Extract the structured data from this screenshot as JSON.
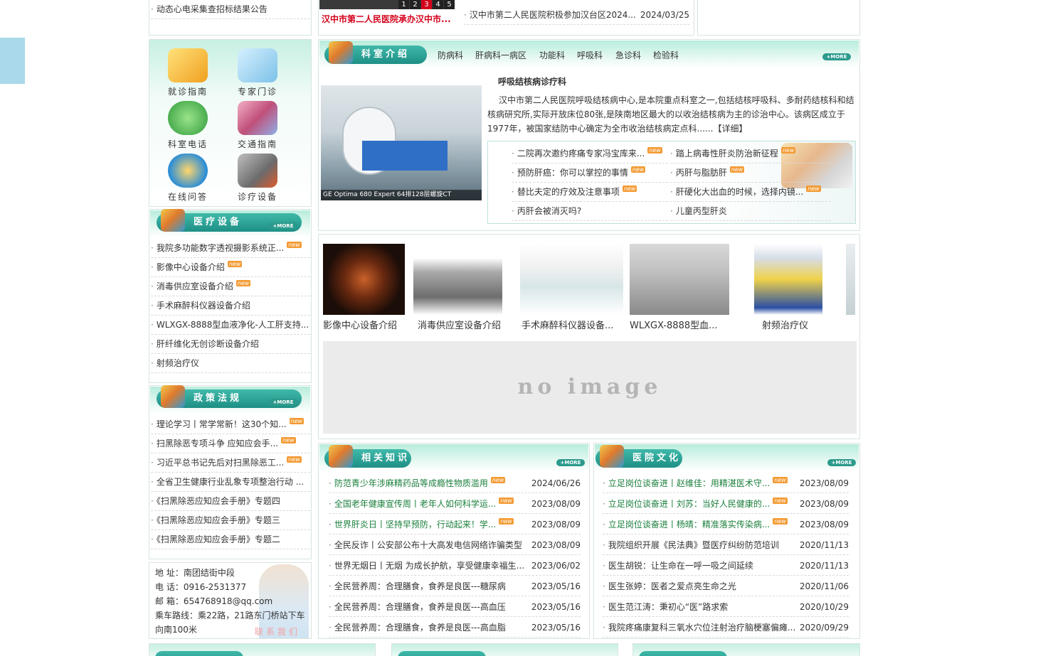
{
  "top": {
    "left_item": "动态心电采集查招标结果公告",
    "slider_caption": "汉中市第二人民医院承办汉中市...",
    "slider_pages": [
      "1",
      "2",
      "3",
      "4",
      "5"
    ],
    "news_item": "汉中市第二人民医院积极参加汉台区2024...",
    "news_date": "2024/03/25"
  },
  "guide": {
    "items": [
      {
        "label": "就诊指南",
        "icon": "scroll-icon"
      },
      {
        "label": "专家门诊",
        "icon": "syringe-icon"
      },
      {
        "label": "科室电话",
        "icon": "phone-icon"
      },
      {
        "label": "交通指南",
        "icon": "castle-icon"
      },
      {
        "label": "在线问答",
        "icon": "globe-mailbox-icon"
      },
      {
        "label": "诊疗设备",
        "icon": "computer-icon"
      }
    ]
  },
  "equipment": {
    "title": "医疗设备",
    "more": "+MORE",
    "items": [
      {
        "text": "我院多功能数字透视摄影系统正...",
        "new": true
      },
      {
        "text": "影像中心设备介绍",
        "new": true
      },
      {
        "text": "消毒供应室设备介绍",
        "new": true
      },
      {
        "text": "手术麻醉科仪器设备介绍",
        "new": false
      },
      {
        "text": "WLXGX-8888型血液净化-人工肝支持...",
        "new": false
      },
      {
        "text": "肝纤维化无创诊断设备介绍",
        "new": false
      },
      {
        "text": "射频治疗仪",
        "new": false
      }
    ]
  },
  "policy": {
    "title": "政策法规",
    "more": "+MORE",
    "items": [
      {
        "text": "理论学习丨常学常新！这30个知...",
        "new": true
      },
      {
        "text": "扫黑除恶专项斗争 应知应会手...",
        "new": true
      },
      {
        "text": "习近平总书记先后对扫黑除恶工...",
        "new": true
      },
      {
        "text": "全省卫生健康行业乱象专项整治行动 ...",
        "new": false
      },
      {
        "text": "《扫黑除恶应知应会手册》专题四",
        "new": false
      },
      {
        "text": "《扫黑除恶应知应会手册》专题三",
        "new": false
      },
      {
        "text": "《扫黑除恶应知应会手册》专题二",
        "new": false
      }
    ]
  },
  "contact": {
    "address": "地 址：南团结街中段",
    "phone": "电 话：0916-2531377",
    "email": "邮 箱：654768918@qq.com",
    "route": "乘车路线：乘22路，21路东门桥站下车向南100米",
    "badge": "联系我们"
  },
  "departments": {
    "title": "科室介绍",
    "more": "+MORE",
    "tabs": [
      "防病科",
      "肝病科一病区",
      "功能科",
      "呼吸科",
      "急诊科",
      "检验科"
    ],
    "feature_title": "呼吸结核病诊疗科",
    "feature_text": "汉中市第二人民医院呼吸结核病中心,是本院重点科室之一,包括结核呼吸科、多耐药结核科和结核病研究所,实际开放床位80张,是陕南地区最大的以收治结核病为主的诊治中心。该病区成立于1977年，被国家结防中心确定为全市收治结核病定点科......",
    "detail_link": "【详细】",
    "photo_caption": "GE Optima 680 Expert 64排128层螺旋CT",
    "links_left": [
      {
        "text": "二院再次邀约疼痛专家冯宝库来...",
        "new": true
      },
      {
        "text": "预防肝癌：你可以掌控的事情",
        "new": true
      },
      {
        "text": "替比夫定的疗效及注意事项",
        "new": true
      },
      {
        "text": "丙肝会被消灭吗?",
        "new": false
      }
    ],
    "links_right": [
      {
        "text": "踏上病毒性肝炎防治新征程",
        "new": true
      },
      {
        "text": "丙肝与脂肪肝",
        "new": true
      },
      {
        "text": "肝硬化大出血的时候，选择内镜...",
        "new": true
      },
      {
        "text": "儿童丙型肝炎",
        "new": false
      }
    ]
  },
  "gallery": {
    "captions": [
      "影像中心设备介绍",
      "消毒供应室设备介绍",
      "手术麻醉科仪器设备...",
      "WLXGX-8888型血...",
      "射频治疗仪"
    ],
    "placeholder": "no image"
  },
  "knowledge": {
    "title": "相关知识",
    "more": "+MORE",
    "items": [
      {
        "text": "防范青少年涉麻精药品等成瘾性物质滥用",
        "date": "2024/06/26",
        "new": true,
        "green": true
      },
      {
        "text": "全国老年健康宣传周丨老年人如何科学运...",
        "date": "2023/08/09",
        "new": true,
        "green": true
      },
      {
        "text": "世界肝炎日丨坚持早预防，行动起来！学...",
        "date": "2023/08/09",
        "new": true,
        "green": true
      },
      {
        "text": "全民反诈丨公安部公布十大高发电信网络诈骗类型",
        "date": "2023/08/09",
        "new": false,
        "green": false
      },
      {
        "text": "世界无烟日丨无烟 为成长护航，享受健康幸福生...",
        "date": "2023/06/02",
        "new": false,
        "green": false
      },
      {
        "text": "全民营养周：合理膳食，食养是良医---糖尿病",
        "date": "2023/05/16",
        "new": false,
        "green": false
      },
      {
        "text": "全民营养周：合理膳食，食养是良医---高血压",
        "date": "2023/05/16",
        "new": false,
        "green": false
      },
      {
        "text": "全民营养周：合理膳食，食养是良医---高血脂",
        "date": "2023/05/16",
        "new": false,
        "green": false
      }
    ]
  },
  "culture": {
    "title": "医院文化",
    "more": "+MORE",
    "items": [
      {
        "text": "立足岗位谈奋进丨赵维佳：用精湛医术守...",
        "date": "2023/08/09",
        "new": true,
        "green": true
      },
      {
        "text": "立足岗位谈奋进丨刘苏：当好人民健康的...",
        "date": "2023/08/09",
        "new": true,
        "green": true
      },
      {
        "text": "立足岗位谈奋进丨杨晴：精准落实传染病...",
        "date": "2023/08/09",
        "new": true,
        "green": true
      },
      {
        "text": "我院组织开展《民法典》暨医疗纠纷防范培训",
        "date": "2020/11/13",
        "new": false,
        "green": false
      },
      {
        "text": "医生胡锐：让生命在一呼一吸之间延续",
        "date": "2020/11/13",
        "new": false,
        "green": false
      },
      {
        "text": "医生张婷：医者之爱点亮生命之光",
        "date": "2020/11/06",
        "new": false,
        "green": false
      },
      {
        "text": "医生范江涛：秉初心“医”路求索",
        "date": "2020/10/29",
        "new": false,
        "green": false
      },
      {
        "text": "我院疼痛康复科三氧水穴位注射治疗脑梗塞偏瘫...",
        "date": "2020/09/29",
        "new": false,
        "green": false
      }
    ]
  },
  "colors": {
    "accent": "#1e8f86",
    "header_gradient": "#b8ecdc",
    "new_badge": "#f39a32",
    "link_green": "#1a7f3c",
    "slider_caption_red": "#d4001a",
    "side_tab": "#a9d9ea"
  }
}
